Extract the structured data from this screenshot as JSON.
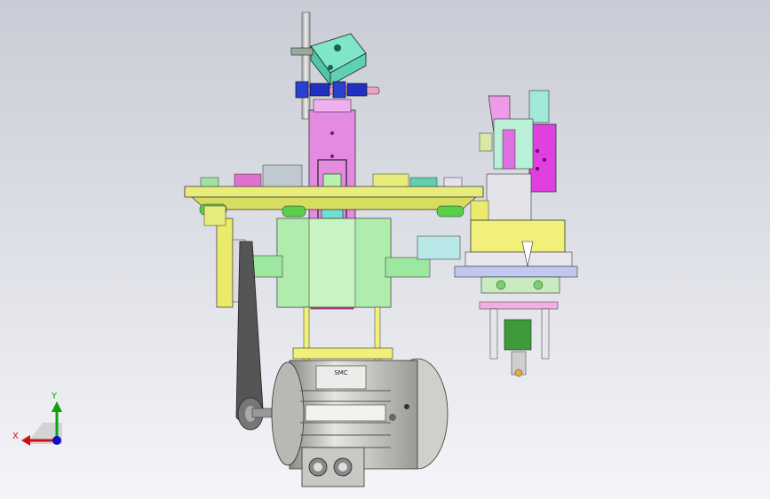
{
  "viewport": {
    "background_top": "#c9ccd6",
    "background_bottom": "#f4f5f8"
  },
  "model": {
    "motor_nameplate": "SMC"
  },
  "triad": {
    "x_label": "X",
    "y_label": "Y",
    "x_color": "#d01010",
    "y_color": "#10a010",
    "z_color": "#1010c0"
  },
  "colors": {
    "pink": "#e07ee0",
    "green_light": "#b8f0b0",
    "yellow": "#f0f07a",
    "cyan": "#8ff0e0",
    "blue": "#2030c0",
    "gray_dark": "#404040",
    "gray_motor": "#d0d0cc",
    "magenta": "#e040e0"
  }
}
